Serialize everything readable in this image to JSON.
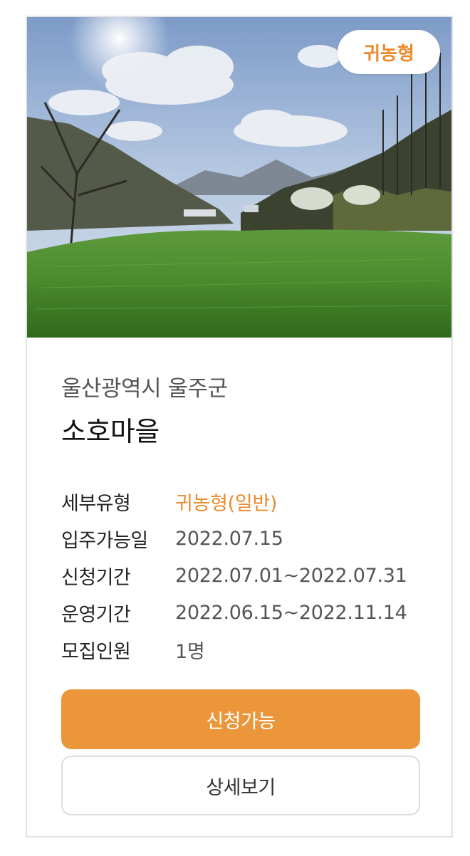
{
  "card": {
    "type_badge": "귀농형",
    "region": "울산광역시 울주군",
    "village_name": "소호마을",
    "details": [
      {
        "label": "세부유형",
        "value": "귀농형(일반)",
        "accent": true
      },
      {
        "label": "입주가능일",
        "value": "2022.07.15",
        "accent": false
      },
      {
        "label": "신청기간",
        "value": "2022.07.01~2022.07.31",
        "accent": false
      },
      {
        "label": "운영기간",
        "value": "2022.06.15~2022.11.14",
        "accent": false
      },
      {
        "label": "모집인원",
        "value": "1명",
        "accent": false
      }
    ],
    "apply_button_label": "신청가능",
    "detail_button_label": "상세보기"
  },
  "colors": {
    "accent": "#ec8a2a",
    "apply_button": "#ec963c",
    "border": "#e3e3e3"
  }
}
